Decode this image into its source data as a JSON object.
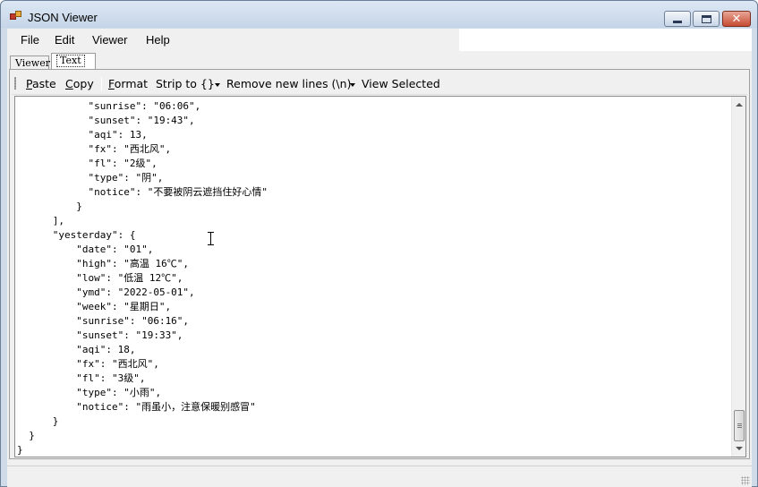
{
  "window": {
    "title": "JSON Viewer",
    "icon": "app-icon",
    "controls": [
      "minimize-icon",
      "maximize-icon",
      "close-icon"
    ],
    "close_glyph": "✕"
  },
  "menu": {
    "items": [
      "File",
      "Edit",
      "Viewer",
      "Help"
    ]
  },
  "tabs": {
    "viewer": "Viewer",
    "text": "Text",
    "selected": "Text"
  },
  "toolbar": {
    "paste": {
      "accel": "P",
      "rest": "aste"
    },
    "copy": {
      "accel": "C",
      "rest": "opy"
    },
    "format": {
      "accel": "F",
      "rest": "ormat"
    },
    "strip": "Strip to {}",
    "remove_newlines": "Remove new lines (\\n)",
    "view_selected": "View Selected"
  },
  "editor": {
    "lines": [
      "            \"sunrise\": \"06:06\",",
      "            \"sunset\": \"19:43\",",
      "            \"aqi\": 13,",
      "            \"fx\": \"西北风\",",
      "            \"fl\": \"2级\",",
      "            \"type\": \"阴\",",
      "            \"notice\": \"不要被阴云遮挡住好心情\"",
      "          }",
      "      ],",
      "      \"yesterday\": {",
      "          \"date\": \"01\",",
      "          \"high\": \"高温 16℃\",",
      "          \"low\": \"低温 12℃\",",
      "          \"ymd\": \"2022-05-01\",",
      "          \"week\": \"星期日\",",
      "          \"sunrise\": \"06:16\",",
      "          \"sunset\": \"19:33\",",
      "          \"aqi\": 18,",
      "          \"fx\": \"西北风\",",
      "          \"fl\": \"3级\",",
      "          \"type\": \"小雨\",",
      "          \"notice\": \"雨虽小，注意保暖别感冒\"",
      "      }",
      "  }",
      "}"
    ]
  },
  "colors": {
    "titlebar": "#c5d5e8",
    "close_button": "#c74b32",
    "client_bg": "#f0f0f0",
    "editor_bg": "#ffffff"
  }
}
